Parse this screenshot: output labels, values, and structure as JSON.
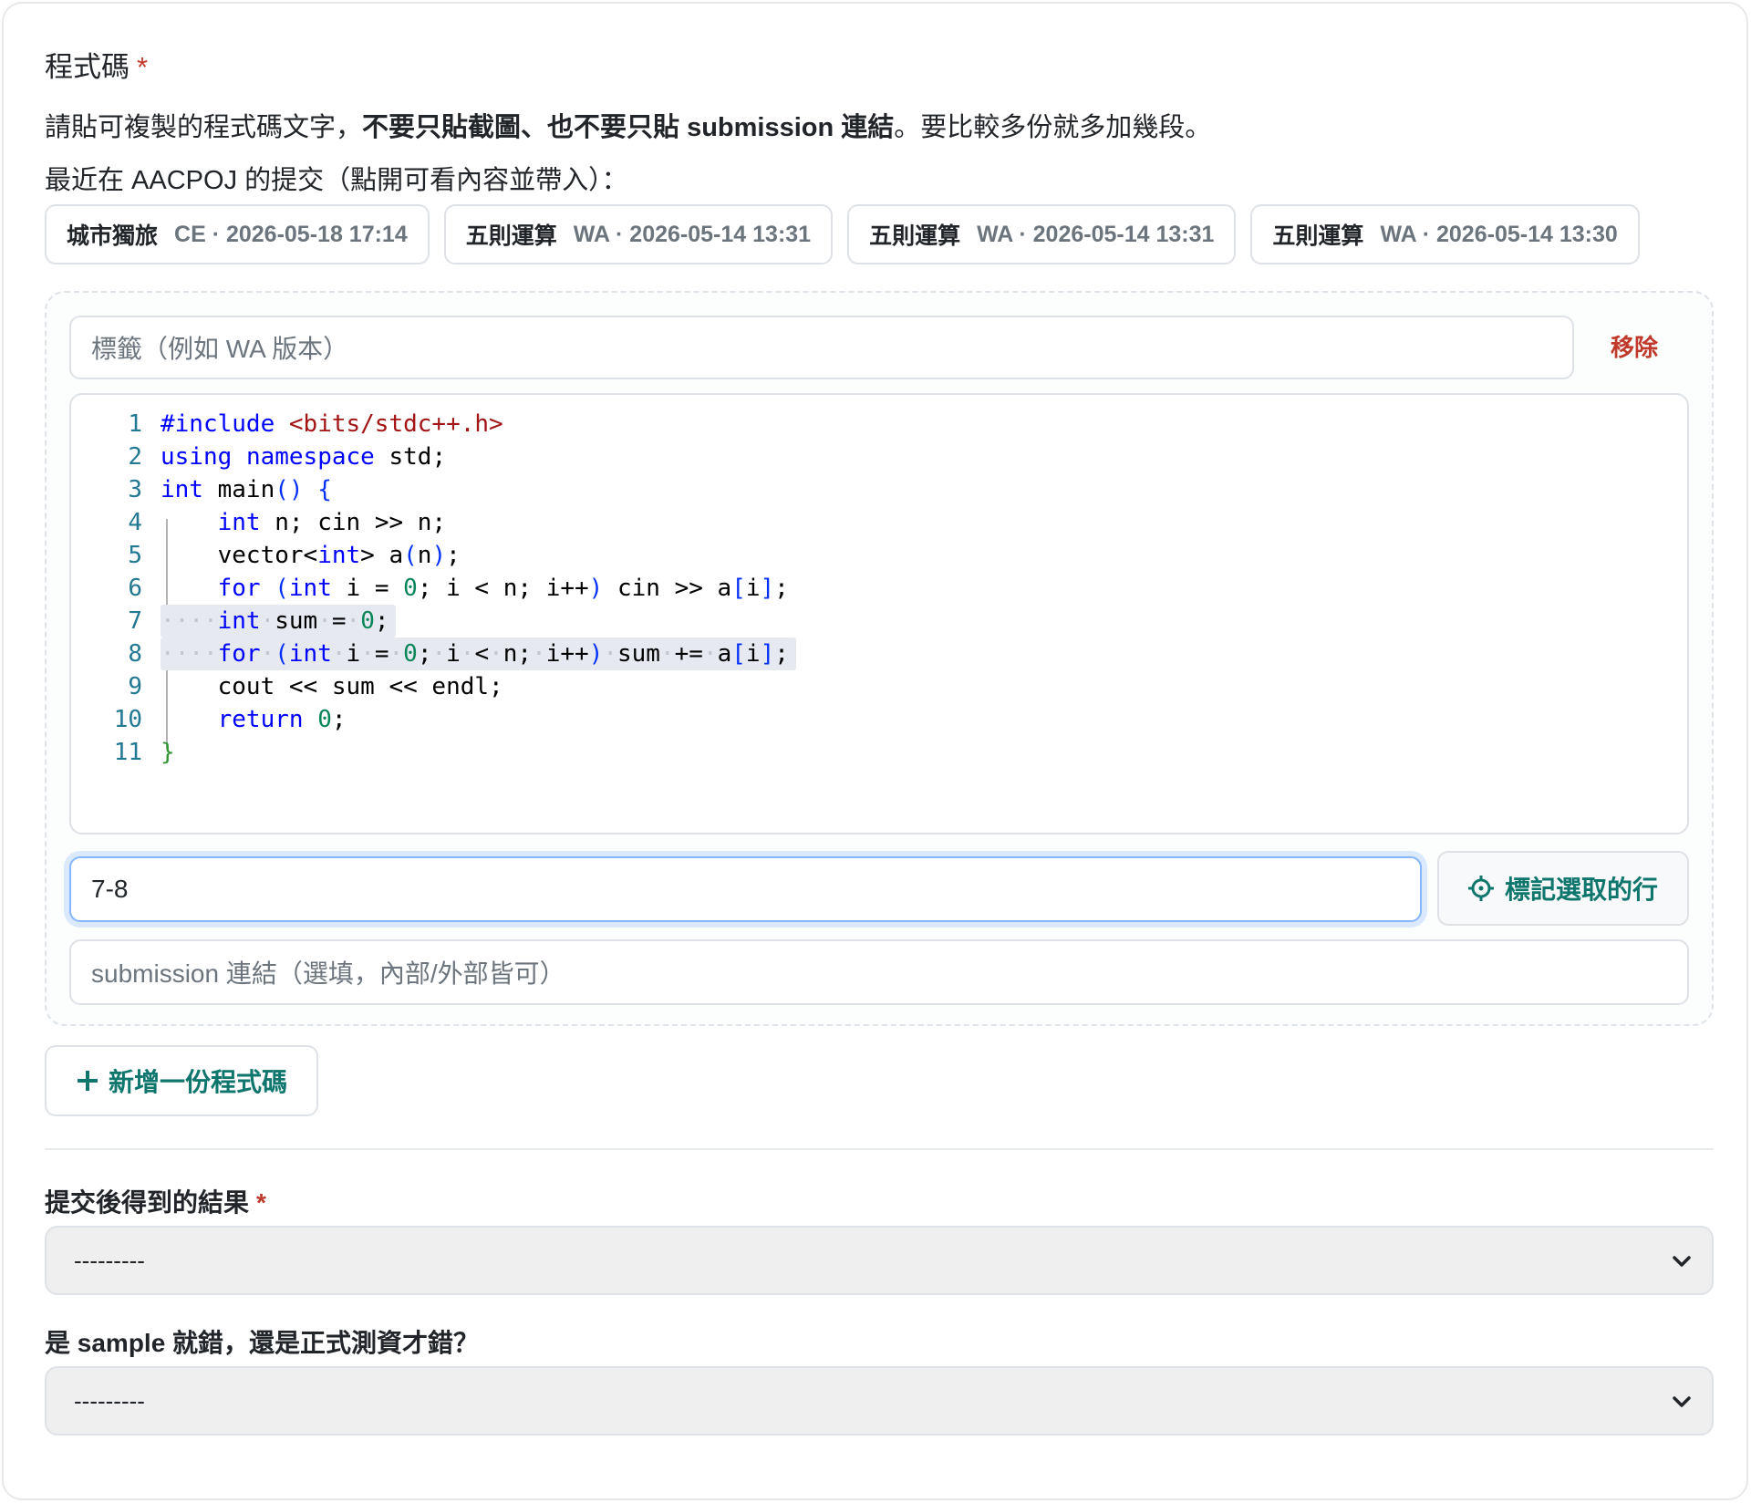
{
  "code_field": {
    "label": "程式碼",
    "required_mark": "*",
    "help_prefix": "請貼可複製的程式碼文字，",
    "help_bold": "不要只貼截圖、也不要只貼 submission 連結",
    "help_suffix": "。要比較多份就多加幾段。",
    "recent_label": "最近在 AACPOJ 的提交（點開可看內容並帶入）："
  },
  "recent_submissions": [
    {
      "name": "城市獨旅",
      "meta": "CE · 2026-05-18 17:14"
    },
    {
      "name": "五則運算",
      "meta": "WA · 2026-05-14 13:31"
    },
    {
      "name": "五則運算",
      "meta": "WA · 2026-05-14 13:31"
    },
    {
      "name": "五則運算",
      "meta": "WA · 2026-05-14 13:30"
    }
  ],
  "code_block": {
    "label_placeholder": "標籤（例如 WA 版本）",
    "remove_label": "移除",
    "line_numbers": [
      "1",
      "2",
      "3",
      "4",
      "5",
      "6",
      "7",
      "8",
      "9",
      "10",
      "11"
    ],
    "code_lines": [
      "#include <bits/stdc++.h>",
      "using namespace std;",
      "int main() {",
      "    int n; cin >> n;",
      "    vector<int> a(n);",
      "    for (int i = 0; i < n; i++) cin >> a[i];",
      "    int sum = 0;",
      "    for (int i = 0; i < n; i++) sum += a[i];",
      "    cout << sum << endl;",
      "    return 0;",
      "}"
    ],
    "highlighted_lines": [
      7,
      8
    ],
    "line_range_value": "7-8",
    "mark_button_label": "標記選取的行",
    "link_placeholder": "submission 連結（選填，內部/外部皆可）"
  },
  "add_code_label": "新增一份程式碼",
  "result_field": {
    "label": "提交後得到的結果",
    "required_mark": "*",
    "selected": "---------"
  },
  "sample_field": {
    "label": "是 sample 就錯，還是正式測資才錯？",
    "selected": "---------"
  },
  "colors": {
    "accent": "#0f766e",
    "danger": "#c0392b",
    "keyword": "#0000ff",
    "string": "#a31515",
    "type": "#267f99",
    "number": "#098658",
    "line_number": "#237893",
    "highlight": "#e6e9ef"
  },
  "icons": {
    "mark": "crosshair-icon",
    "add": "plus-icon",
    "select_arrow": "chevron-down-icon"
  }
}
